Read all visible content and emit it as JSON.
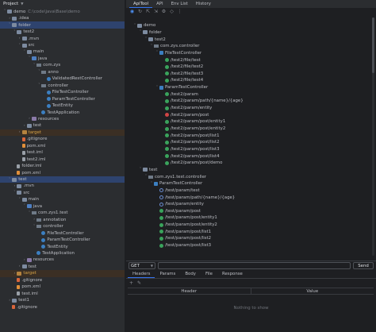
{
  "project": {
    "header": "Project",
    "tree": [
      {
        "depth": 0,
        "chev": "v",
        "icon": "folder",
        "label": "demo",
        "hint": "C:\\code\\java\\Base\\demo",
        "state": ""
      },
      {
        "depth": 1,
        "chev": ">",
        "icon": "folder",
        "label": ".idea",
        "state": ""
      },
      {
        "depth": 1,
        "chev": "v",
        "icon": "folder",
        "label": "folder",
        "state": "sel"
      },
      {
        "depth": 2,
        "chev": "v",
        "icon": "folder",
        "label": "test2",
        "state": ""
      },
      {
        "depth": 3,
        "chev": ">",
        "icon": "folder",
        "label": ".mvn",
        "state": ""
      },
      {
        "depth": 3,
        "chev": "v",
        "icon": "folder",
        "label": "src",
        "state": ""
      },
      {
        "depth": 4,
        "chev": "v",
        "icon": "folder",
        "label": "main",
        "state": ""
      },
      {
        "depth": 5,
        "chev": "v",
        "icon": "folder-src",
        "label": "java",
        "state": ""
      },
      {
        "depth": 6,
        "chev": "v",
        "icon": "pkg",
        "label": "com.zys",
        "state": ""
      },
      {
        "depth": 7,
        "chev": "v",
        "icon": "pkg",
        "label": "anno",
        "state": ""
      },
      {
        "depth": 8,
        "chev": "",
        "icon": "cls",
        "label": "ValidatedRestController",
        "state": ""
      },
      {
        "depth": 7,
        "chev": "v",
        "icon": "pkg",
        "label": "controller",
        "state": ""
      },
      {
        "depth": 8,
        "chev": "",
        "icon": "cls",
        "label": "FileTestController",
        "state": ""
      },
      {
        "depth": 8,
        "chev": "",
        "icon": "cls",
        "label": "ParamTestController",
        "state": ""
      },
      {
        "depth": 8,
        "chev": "",
        "icon": "cls",
        "label": "TestEntity",
        "state": ""
      },
      {
        "depth": 7,
        "chev": "",
        "icon": "cls",
        "label": "TestApplication",
        "state": ""
      },
      {
        "depth": 5,
        "chev": ">",
        "icon": "folder-res",
        "label": "resources",
        "state": ""
      },
      {
        "depth": 4,
        "chev": ">",
        "icon": "folder",
        "label": "test",
        "state": ""
      },
      {
        "depth": 3,
        "chev": ">",
        "icon": "folder-excl",
        "label": "target",
        "state": "excl"
      },
      {
        "depth": 3,
        "chev": "",
        "icon": "git",
        "label": ".gitignore",
        "state": ""
      },
      {
        "depth": 3,
        "chev": "",
        "icon": "xml",
        "label": "pom.xml",
        "state": ""
      },
      {
        "depth": 3,
        "chev": "",
        "icon": "iml",
        "label": "test.iml",
        "state": ""
      },
      {
        "depth": 3,
        "chev": "",
        "icon": "iml",
        "label": "test2.iml",
        "state": ""
      },
      {
        "depth": 2,
        "chev": "",
        "icon": "iml",
        "label": "folder.iml",
        "state": ""
      },
      {
        "depth": 2,
        "chev": "",
        "icon": "xml",
        "label": "pom.xml",
        "state": ""
      },
      {
        "depth": 1,
        "chev": "v",
        "icon": "folder",
        "label": "test",
        "state": "sel"
      },
      {
        "depth": 2,
        "chev": ">",
        "icon": "folder",
        "label": ".mvn",
        "state": ""
      },
      {
        "depth": 2,
        "chev": "v",
        "icon": "folder",
        "label": "src",
        "state": ""
      },
      {
        "depth": 3,
        "chev": "v",
        "icon": "folder",
        "label": "main",
        "state": ""
      },
      {
        "depth": 4,
        "chev": "v",
        "icon": "folder-src",
        "label": "java",
        "state": ""
      },
      {
        "depth": 5,
        "chev": "v",
        "icon": "pkg",
        "label": "com.zys1.test",
        "state": ""
      },
      {
        "depth": 6,
        "chev": ">",
        "icon": "pkg",
        "label": "annotation",
        "state": ""
      },
      {
        "depth": 6,
        "chev": "v",
        "icon": "pkg",
        "label": "controller",
        "state": ""
      },
      {
        "depth": 7,
        "chev": "",
        "icon": "cls",
        "label": "FileTestController",
        "state": ""
      },
      {
        "depth": 7,
        "chev": "",
        "icon": "cls",
        "label": "ParamTestController",
        "state": ""
      },
      {
        "depth": 7,
        "chev": "",
        "icon": "cls",
        "label": "TestEntity",
        "state": ""
      },
      {
        "depth": 6,
        "chev": "",
        "icon": "cls",
        "label": "TestApplication",
        "state": ""
      },
      {
        "depth": 4,
        "chev": ">",
        "icon": "folder-res",
        "label": "resources",
        "state": ""
      },
      {
        "depth": 3,
        "chev": ">",
        "icon": "folder",
        "label": "test",
        "state": ""
      },
      {
        "depth": 2,
        "chev": ">",
        "icon": "folder-excl",
        "label": "target",
        "state": "excl"
      },
      {
        "depth": 2,
        "chev": "",
        "icon": "git",
        "label": ".gitignore",
        "state": ""
      },
      {
        "depth": 2,
        "chev": "",
        "icon": "xml",
        "label": "pom.xml",
        "state": ""
      },
      {
        "depth": 2,
        "chev": "",
        "icon": "iml",
        "label": "test.iml",
        "state": ""
      },
      {
        "depth": 1,
        "chev": ">",
        "icon": "folder",
        "label": "test1",
        "state": ""
      },
      {
        "depth": 1,
        "chev": "",
        "icon": "git",
        "label": ".gitignore",
        "state": ""
      }
    ]
  },
  "apitool": {
    "tabs": [
      "ApiTool",
      "API",
      "Env List",
      "History"
    ],
    "active_tab": 0,
    "toolbar": [
      "globe-icon",
      "refresh-icon",
      "collapse-icon",
      "expand-icon",
      "settings-icon",
      "filter-icon",
      "more-icon"
    ],
    "tree": [
      {
        "depth": 0,
        "chev": "v",
        "icon": "folder",
        "label": "demo"
      },
      {
        "depth": 1,
        "chev": "v",
        "icon": "folder",
        "label": "folder"
      },
      {
        "depth": 2,
        "chev": "v",
        "icon": "folder",
        "label": "test2"
      },
      {
        "depth": 3,
        "chev": "v",
        "icon": "pkg",
        "label": "com.zys.controller"
      },
      {
        "depth": 4,
        "chev": "v",
        "icon": "ctrl",
        "label": "FileTestController"
      },
      {
        "depth": 5,
        "chev": "",
        "icon": "G",
        "label": "/test2/file/test"
      },
      {
        "depth": 5,
        "chev": "",
        "icon": "G",
        "label": "/test2/file/test2"
      },
      {
        "depth": 5,
        "chev": "",
        "icon": "G",
        "label": "/test2/file/test3"
      },
      {
        "depth": 5,
        "chev": "",
        "icon": "G",
        "label": "/test2/file/test4"
      },
      {
        "depth": 4,
        "chev": "v",
        "icon": "ctrl",
        "label": "ParamTestController"
      },
      {
        "depth": 5,
        "chev": "",
        "icon": "G",
        "label": "/test2/param"
      },
      {
        "depth": 5,
        "chev": "",
        "icon": "G",
        "label": "/test2/param/path/{name}/{age}"
      },
      {
        "depth": 5,
        "chev": "",
        "icon": "G",
        "label": "/test2/param/entity"
      },
      {
        "depth": 5,
        "chev": "",
        "icon": "D",
        "label": "/test2/param/post"
      },
      {
        "depth": 5,
        "chev": "",
        "icon": "G",
        "label": "/test2/param/post/entity1"
      },
      {
        "depth": 5,
        "chev": "",
        "icon": "G",
        "label": "/test2/param/post/entity2"
      },
      {
        "depth": 5,
        "chev": "",
        "icon": "G",
        "label": "/test2/param/post/list1"
      },
      {
        "depth": 5,
        "chev": "",
        "icon": "G",
        "label": "/test2/param/post/list2"
      },
      {
        "depth": 5,
        "chev": "",
        "icon": "G",
        "label": "/test2/param/post/list3"
      },
      {
        "depth": 5,
        "chev": "",
        "icon": "G",
        "label": "/test2/param/post/list4"
      },
      {
        "depth": 5,
        "chev": "",
        "icon": "G",
        "label": "/test2/param/post/demo"
      },
      {
        "depth": 1,
        "chev": "v",
        "icon": "folder",
        "label": "test"
      },
      {
        "depth": 2,
        "chev": "v",
        "icon": "pkg",
        "label": "com.zys1.test.controller"
      },
      {
        "depth": 3,
        "chev": "v",
        "icon": "ctrl",
        "label": "ParamTestController"
      },
      {
        "depth": 4,
        "chev": "",
        "icon": "Gout",
        "label": "/test/param/test"
      },
      {
        "depth": 4,
        "chev": "",
        "icon": "Gout",
        "label": "/test/param/path/{name}/{age}"
      },
      {
        "depth": 4,
        "chev": "",
        "icon": "Gout",
        "label": "/test/param/entity"
      },
      {
        "depth": 4,
        "chev": "",
        "icon": "P",
        "label": "/test/param/post"
      },
      {
        "depth": 4,
        "chev": "",
        "icon": "P",
        "label": "/test/param/post/entity1"
      },
      {
        "depth": 4,
        "chev": "",
        "icon": "P",
        "label": "/test/param/post/entity2"
      },
      {
        "depth": 4,
        "chev": "",
        "icon": "P",
        "label": "/test/param/post/list1"
      },
      {
        "depth": 4,
        "chev": "",
        "icon": "P",
        "label": "/test/param/post/list2"
      },
      {
        "depth": 4,
        "chev": "",
        "icon": "P",
        "label": "/test/param/post/list3"
      }
    ],
    "request": {
      "method": "GET",
      "url_value": "",
      "send_label": "Send"
    },
    "subtabs": [
      "Headers",
      "Params",
      "Body",
      "File",
      "Response"
    ],
    "active_subtab": 0,
    "kv_headers": {
      "key": "Header",
      "value": "Value"
    },
    "empty_text": "Nothing to show"
  },
  "colors": {
    "accent": "#3574f0",
    "selection": "#2e436e",
    "excluded": "#3b2f24"
  }
}
